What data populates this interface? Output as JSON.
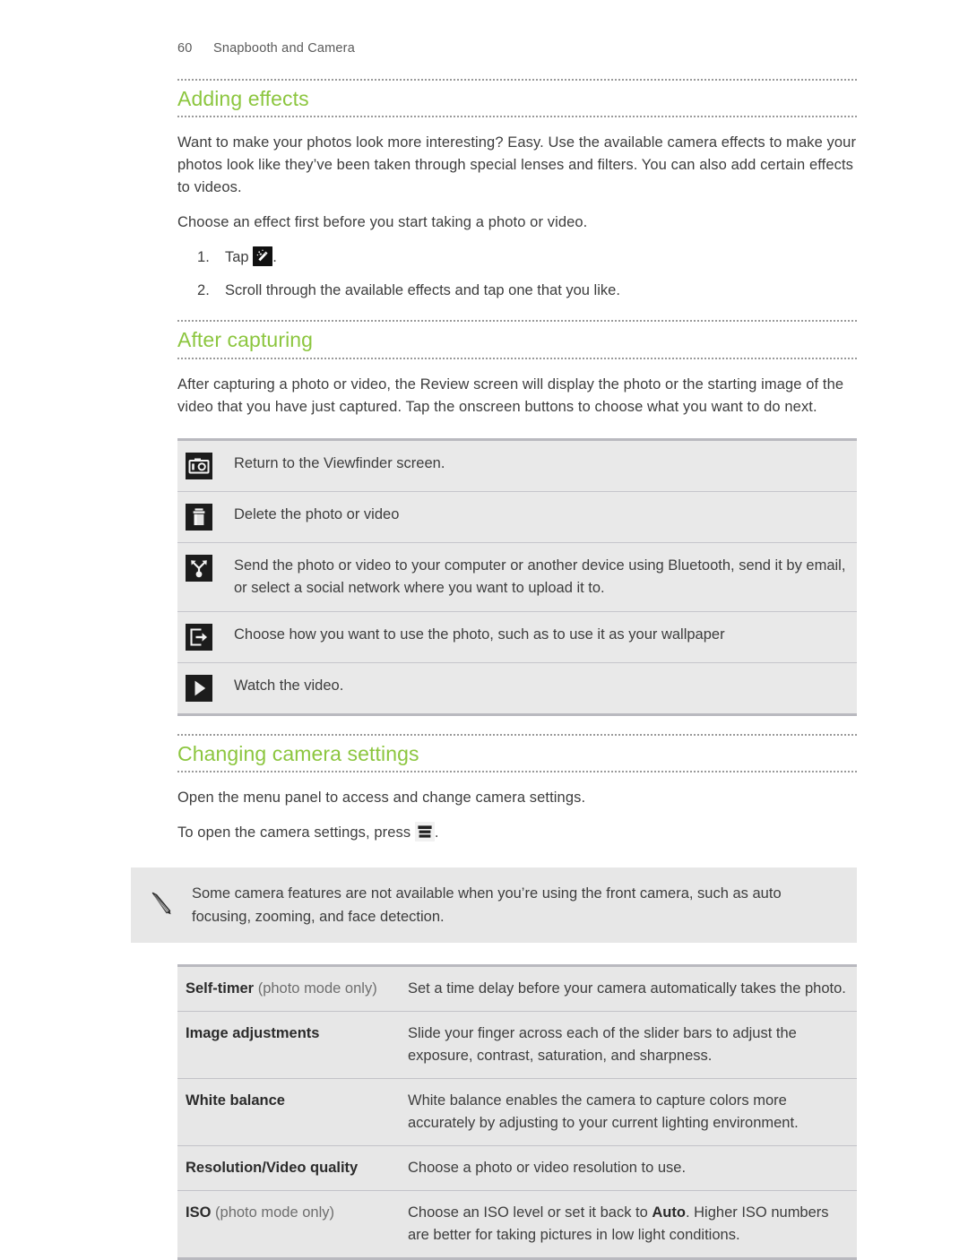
{
  "running_head": {
    "page_number": "60",
    "title": "Snapbooth and Camera"
  },
  "colors": {
    "heading_green": "#8cc63f",
    "table_bg": "#e7e7e7",
    "body_text": "#3d3d3d"
  },
  "sections": [
    {
      "heading": "Adding effects",
      "paragraphs": [
        "Want to make your photos look more interesting? Easy. Use the available camera effects to make your photos look like they’ve been taken through special lenses and filters. You can also add certain effects to videos.",
        "Choose an effect first before you start taking a photo or video."
      ],
      "steps": [
        {
          "prefix": "Tap",
          "icon": "magic-wand-icon",
          "suffix": "."
        },
        {
          "text": "Scroll through the available effects and tap one that you like."
        }
      ]
    },
    {
      "heading": "After capturing",
      "paragraphs": [
        "After capturing a photo or video, the Review screen will display the photo or the starting image of the video that you have just captured. Tap the onscreen buttons to choose what you want to do next."
      ]
    },
    {
      "heading": "Changing camera settings",
      "paragraphs": [
        "Open the menu panel to access and change camera settings."
      ],
      "press_line": {
        "prefix": "To open the camera settings, press",
        "icon": "menu-icon",
        "suffix": "."
      }
    }
  ],
  "icon_table": {
    "rows": [
      {
        "icon": "camera-icon",
        "text": "Return to the Viewfinder screen."
      },
      {
        "icon": "trash-icon",
        "text": "Delete the photo or video"
      },
      {
        "icon": "share-icon",
        "text": "Send the photo or video to your computer or another device using Bluetooth, send it by email, or select a social network where you want to upload it to."
      },
      {
        "icon": "export-icon",
        "text": "Choose how you want to use the photo, such as to use it as your wallpaper"
      },
      {
        "icon": "play-icon",
        "text": "Watch the video."
      }
    ]
  },
  "note": {
    "icon": "pencil-icon",
    "text": "Some camera features are not available when you’re using the front camera, such as auto focusing, zooming, and face detection."
  },
  "settings_table": {
    "rows": [
      {
        "key_strong": "Self-timer",
        "key_muted": " (photo mode only)",
        "value_pre": "Set a time delay before your camera automatically takes the photo.",
        "value_strong": "",
        "value_post": ""
      },
      {
        "key_strong": "Image adjustments",
        "key_muted": "",
        "value_pre": "Slide your finger across each of the slider bars to adjust the exposure, contrast, saturation, and sharpness.",
        "value_strong": "",
        "value_post": ""
      },
      {
        "key_strong": "White balance",
        "key_muted": "",
        "value_pre": "White balance enables the camera to capture colors more accurately by adjusting to your current lighting environment.",
        "value_strong": "",
        "value_post": ""
      },
      {
        "key_strong": "Resolution/Video quality",
        "key_muted": "",
        "value_pre": "Choose a photo or video resolution to use.",
        "value_strong": "",
        "value_post": ""
      },
      {
        "key_strong": "ISO",
        "key_muted": " (photo mode only)",
        "value_pre": "Choose an ISO level or set it back to ",
        "value_strong": "Auto",
        "value_post": ". Higher ISO numbers are better for taking pictures in low light conditions."
      }
    ]
  }
}
